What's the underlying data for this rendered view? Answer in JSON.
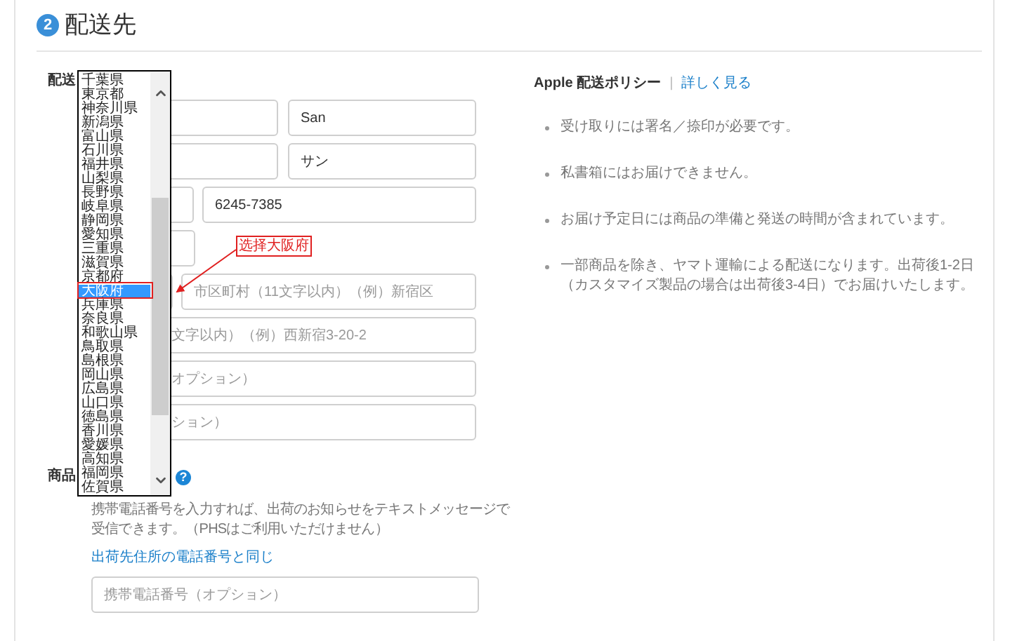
{
  "step": {
    "number": "2",
    "title": "配送先"
  },
  "form": {
    "label": "配送",
    "rows": [
      {
        "kind": "name",
        "value": "San"
      },
      {
        "kind": "name",
        "value": "サン"
      },
      {
        "kind": "phone",
        "value": "6245-7385"
      },
      {
        "kind": "short"
      },
      {
        "kind": "city",
        "placeholder": "市区町村（11文字以内）（例）新宿区"
      },
      {
        "kind": "wide",
        "placeholder": "文字以内）（例）西新宿3-20-2"
      },
      {
        "kind": "wide",
        "placeholder": "オプション）"
      },
      {
        "kind": "wide",
        "placeholder": "ション）"
      }
    ]
  },
  "notifications": {
    "label": "商品",
    "help": "?",
    "description": "携帯電話番号を入力すれば、出荷のお知らせをテキストメッセージで受信できます。（PHSはご利用いただけません）",
    "link": "出荷先住所の電話番号と同じ",
    "field": {
      "placeholder": "携帯電話番号（オプション）"
    }
  },
  "prefecture_dropdown": {
    "options": [
      {
        "label": "千葉県",
        "selected": false
      },
      {
        "label": "東京都",
        "selected": false
      },
      {
        "label": "神奈川県",
        "selected": false
      },
      {
        "label": "新潟県",
        "selected": false
      },
      {
        "label": "富山県",
        "selected": false
      },
      {
        "label": "石川県",
        "selected": false
      },
      {
        "label": "福井県",
        "selected": false
      },
      {
        "label": "山梨県",
        "selected": false
      },
      {
        "label": "長野県",
        "selected": false
      },
      {
        "label": "岐阜県",
        "selected": false
      },
      {
        "label": "静岡県",
        "selected": false
      },
      {
        "label": "愛知県",
        "selected": false
      },
      {
        "label": "三重県",
        "selected": false
      },
      {
        "label": "滋賀県",
        "selected": false
      },
      {
        "label": "京都府",
        "selected": false
      },
      {
        "label": "大阪府",
        "selected": true
      },
      {
        "label": "兵庫県",
        "selected": false
      },
      {
        "label": "奈良県",
        "selected": false
      },
      {
        "label": "和歌山県",
        "selected": false
      },
      {
        "label": "鳥取県",
        "selected": false
      },
      {
        "label": "島根県",
        "selected": false
      },
      {
        "label": "岡山県",
        "selected": false
      },
      {
        "label": "広島県",
        "selected": false
      },
      {
        "label": "山口県",
        "selected": false
      },
      {
        "label": "徳島県",
        "selected": false
      },
      {
        "label": "香川県",
        "selected": false
      },
      {
        "label": "愛媛県",
        "selected": false
      },
      {
        "label": "高知県",
        "selected": false
      },
      {
        "label": "福岡県",
        "selected": false
      },
      {
        "label": "佐賀県",
        "selected": false
      }
    ]
  },
  "annotation": {
    "label": "选择大阪府"
  },
  "policy": {
    "title": "Apple 配送ポリシー",
    "separator": "|",
    "link": "詳しく見る",
    "items": [
      "受け取りには署名／捺印が必要です。",
      "私書箱にはお届けできません。",
      "お届け予定日には商品の準備と発送の時間が含まれています。",
      "一部商品を除き、ヤマト運輸による配送になります。出荷後1-2日（カスタマイズ製品の場合は出荷後3-4日）でお届けいたします。"
    ]
  }
}
